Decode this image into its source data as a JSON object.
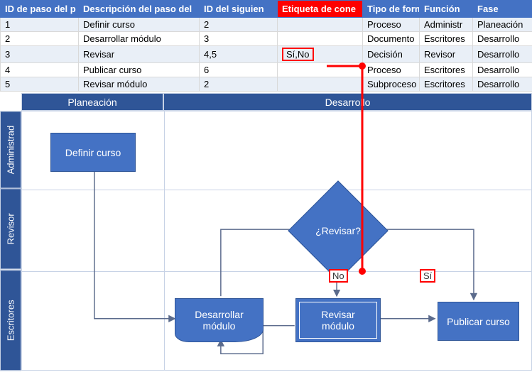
{
  "table": {
    "headers": {
      "step_id": "ID de paso del p",
      "description": "Descripción del paso del",
      "next_id": "ID del siguien",
      "connector_label": "Etiqueta de cone",
      "shape_type": "Tipo de form",
      "function": "Función",
      "phase": "Fase"
    },
    "rows": [
      {
        "id": "1",
        "desc": "Definir curso",
        "next": "2",
        "conn": "",
        "type": "Proceso",
        "func": "Administr",
        "phase": "Planeación"
      },
      {
        "id": "2",
        "desc": "Desarrollar módulo",
        "next": "3",
        "conn": "",
        "type": "Documento",
        "func": "Escritores",
        "phase": "Desarrollo"
      },
      {
        "id": "3",
        "desc": "Revisar",
        "next": "4,5",
        "conn": "Sí,No",
        "type": "Decisión",
        "func": "Revisor",
        "phase": "Desarrollo"
      },
      {
        "id": "4",
        "desc": "Publicar curso",
        "next": "6",
        "conn": "",
        "type": "Proceso",
        "func": "Escritores",
        "phase": "Desarrollo"
      },
      {
        "id": "5",
        "desc": "Revisar módulo",
        "next": "2",
        "conn": "",
        "type": "Subproceso",
        "func": "Escritores",
        "phase": "Desarrollo"
      }
    ]
  },
  "diagram": {
    "phases": {
      "plan": "Planeación",
      "dev": "Desarrollo"
    },
    "lanes": {
      "admin": "Administrad",
      "reviewer": "Revisor",
      "writers": "Escritores"
    },
    "nodes": {
      "define_course": "Definir curso",
      "develop_module": "Desarrollar\nmódulo",
      "review": "¿Revisar?",
      "review_module": "Revisar\nmódulo",
      "publish_course": "Publicar curso"
    },
    "edge_labels": {
      "no": "No",
      "yes": "Sí"
    }
  },
  "callout": {
    "header_highlight": "connector_label",
    "cell_highlight": {
      "row": 2,
      "col": "conn"
    },
    "edge_highlight": [
      "no",
      "yes"
    ]
  }
}
